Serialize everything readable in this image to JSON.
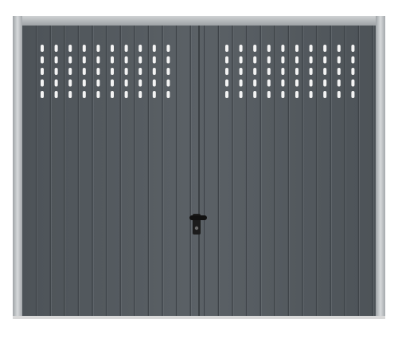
{
  "product": {
    "type": "up-and-over garage door",
    "frame_color": "#b9bdc0",
    "panel_color": "#545a5f",
    "groove_color": "#3f4449",
    "ventilation_slot_color": "#f4f4f4",
    "handle_color": "#1a1a1a",
    "ventilation": {
      "columns_per_side": 10,
      "rows": 5
    }
  }
}
